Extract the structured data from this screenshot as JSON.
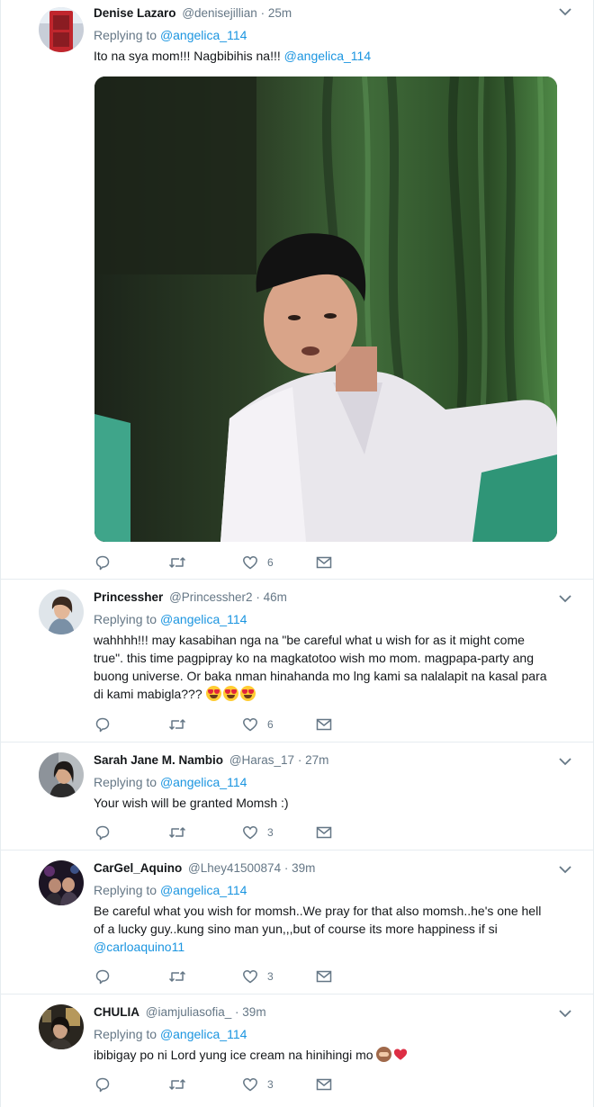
{
  "tweets": [
    {
      "name": "Denise Lazaro",
      "handle": "@denisejillian",
      "time": "25m",
      "replying_prefix": "Replying to",
      "replying_to": "@angelica_114",
      "text": "Ito na sya mom!!! Nagbibihis na!!! ",
      "text_mention": "@angelica_114",
      "likes": "6",
      "has_media": true
    },
    {
      "name": "Princessher",
      "handle": "@Princessher2",
      "time": "46m",
      "replying_prefix": "Replying to",
      "replying_to": "@angelica_114",
      "text_lines": [
        "wahhhh!!! may kasabihan nga na \"be careful what u wish for as it might come",
        "true\". this time pagpipray ko na magkatotoo wish mo mom.  magpapa-party ang",
        "buong universe. Or baka nman hinahanda mo lng kami sa nalalapit na kasal para",
        "di kami mabigla??? "
      ],
      "emojis": [
        "heart-eyes-emoji",
        "heart-eyes-emoji",
        "heart-eyes-emoji"
      ],
      "likes": "6"
    },
    {
      "name": "Sarah Jane M. Nambio",
      "handle": "@Haras_17",
      "time": "27m",
      "replying_prefix": "Replying to",
      "replying_to": "@angelica_114",
      "text": "Your wish will be granted Momsh :)",
      "likes": "3"
    },
    {
      "name": "CarGel_Aquino",
      "handle": "@Lhey41500874",
      "time": "39m",
      "replying_prefix": "Replying to",
      "replying_to": "@angelica_114",
      "text_lines": [
        "Be careful what you wish for momsh..We pray for that also momsh..he's one hell",
        "of a lucky guy..kung sino man yun,,,but of course its more happiness if si"
      ],
      "text_mention": "@carloaquino11",
      "likes": "3"
    },
    {
      "name": "CHULIA",
      "handle": "@iamjuliasofia_",
      "time": "39m",
      "replying_prefix": "Replying to",
      "replying_to": "@angelica_114",
      "text": "ibibigay po ni Lord yung ice cream na hinihingi mo ",
      "emojis": [
        "see-no-evil-monkey-emoji",
        "red-heart-emoji"
      ],
      "likes": "3"
    }
  ],
  "colors": {
    "link": "#1b95e0",
    "secondary_text": "#657786",
    "primary_text": "#14171a",
    "border": "#e6ecf0"
  }
}
